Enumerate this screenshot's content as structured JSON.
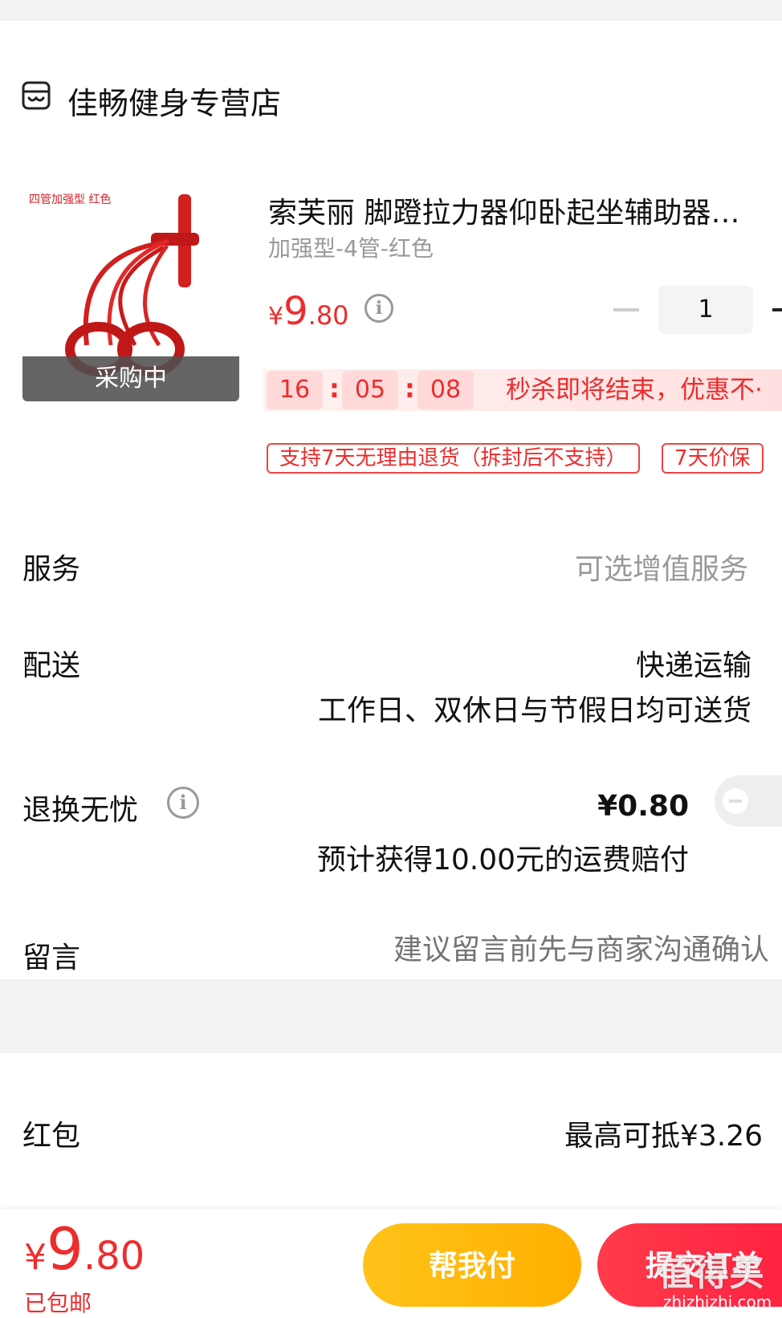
{
  "store": {
    "name": "佳畅健身专营店",
    "icon": "store-icon"
  },
  "product": {
    "image_caption": "四管加强型  红色",
    "status_badge": "采购中",
    "title": "索芙丽 脚蹬拉力器仰卧起坐辅助器…",
    "spec": "加强型-4管-红色",
    "price": {
      "symbol": "¥",
      "integer": "9",
      "decimal": ".80"
    },
    "quantity": "1",
    "countdown": {
      "hours": "16",
      "minutes": "05",
      "seconds": "08",
      "separator": ":",
      "message": "秒杀即将结束，优惠不·"
    },
    "tags": [
      "支持7天无理由退货（拆封后不支持）",
      "7天价保"
    ]
  },
  "rows": {
    "service": {
      "label": "服务",
      "value": "可选增值服务"
    },
    "delivery": {
      "label": "配送",
      "value": "快递运输",
      "sub": "工作日、双休日与节假日均可送货"
    },
    "return": {
      "label": "退换无忧",
      "price": "¥0.80",
      "sub": "预计获得10.00元的运费赔付"
    },
    "message": {
      "label": "留言",
      "placeholder": "建议留言前先与商家沟通确认"
    }
  },
  "coupon": {
    "label": "红包",
    "value": "最高可抵¥3.26"
  },
  "footer": {
    "price": {
      "symbol": "¥",
      "integer": "9",
      "decimal": ".80"
    },
    "free_shipping": "已包邮",
    "help_pay": "帮我付",
    "submit": "提交订单",
    "watermark": "值得买",
    "watermark_url": "zhizhizhi.com"
  },
  "colors": {
    "accent": "#ee2c2c",
    "help_pay": "#ffba00",
    "submit": "#ff2a44"
  }
}
